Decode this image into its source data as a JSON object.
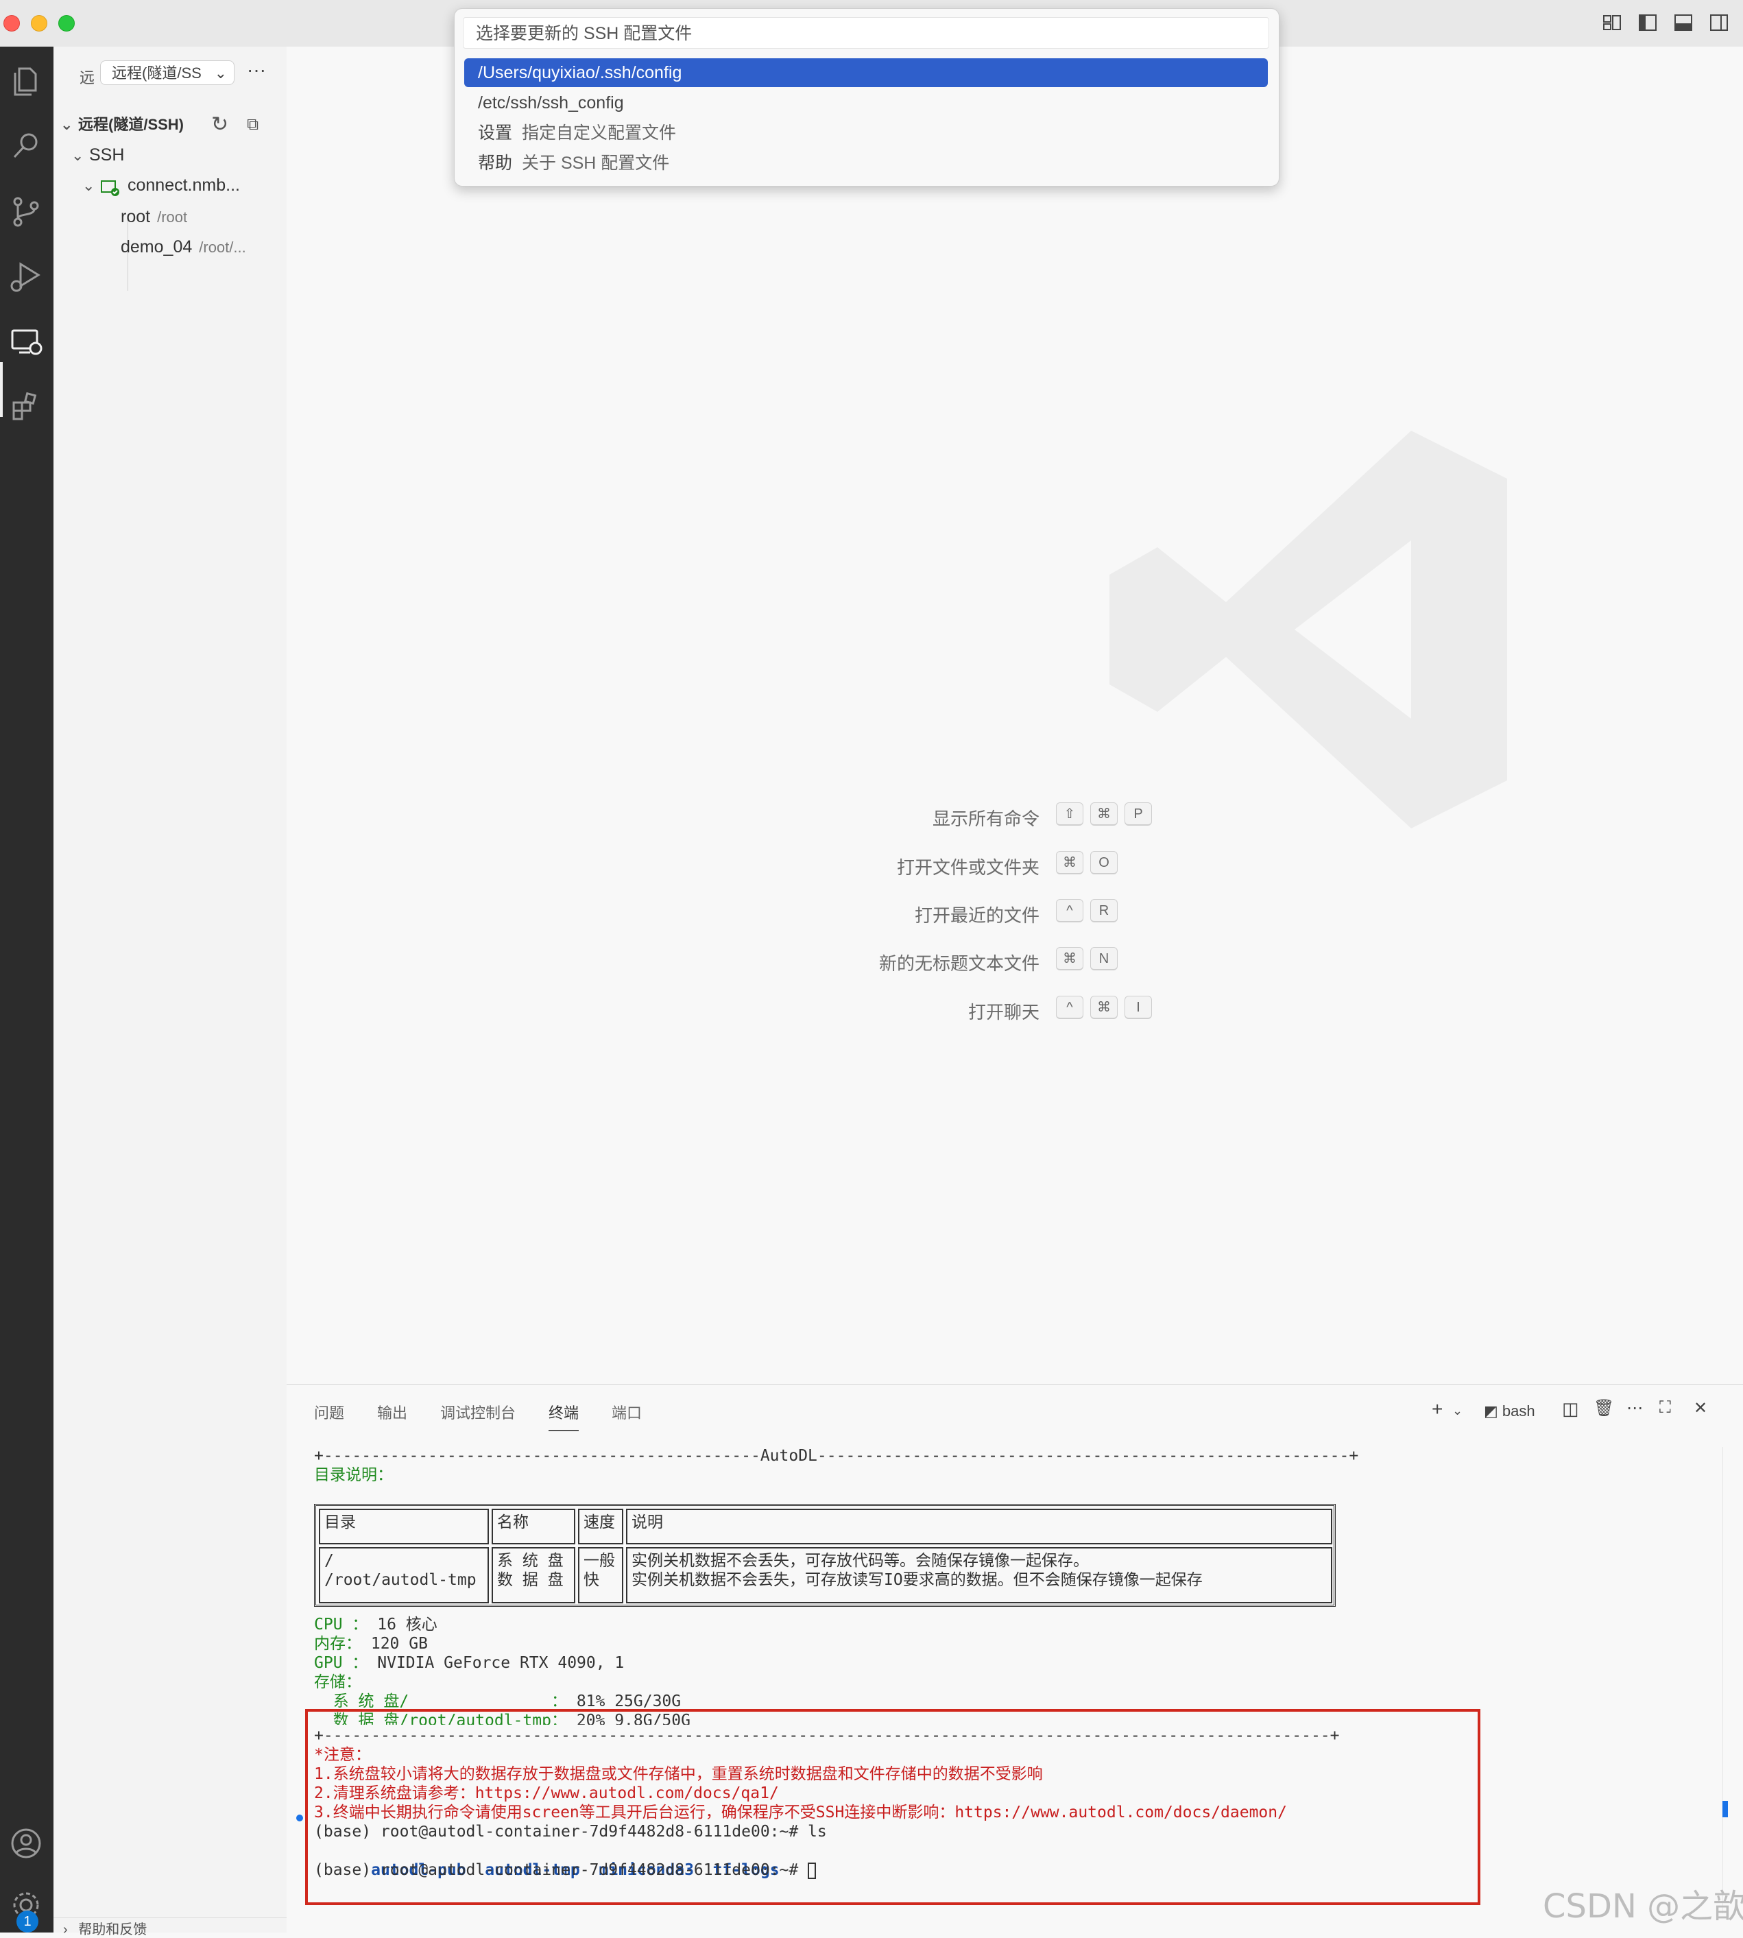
{
  "quickpick": {
    "placeholder": "选择要更新的 SSH 配置文件",
    "items": [
      {
        "label": "/Users/quyixiao/.ssh/config",
        "desc": ""
      },
      {
        "label": "/etc/ssh/ssh_config",
        "desc": ""
      },
      {
        "label": "设置",
        "desc": "指定自定义配置文件"
      },
      {
        "label": "帮助",
        "desc": "关于 SSH 配置文件"
      }
    ]
  },
  "sidebar": {
    "prefix": "远",
    "select_value": "远程(隧道/SS",
    "more": "···",
    "section_title": "远程(隧道/SSH)",
    "group": "SSH",
    "host": "connect.nmb...",
    "folders": [
      {
        "name": "root",
        "path": "/root"
      },
      {
        "name": "demo_04",
        "path": "/root/..."
      }
    ],
    "help": "帮助和反馈"
  },
  "activity": {
    "icons": [
      "files-icon",
      "search-icon",
      "source-control-icon",
      "run-debug-icon",
      "remote-explorer-icon",
      "extensions-icon",
      "account-icon",
      "settings-gear-icon"
    ],
    "badge": "1"
  },
  "shortcuts": [
    {
      "label": "显示所有命令",
      "keys": [
        "⇧",
        "⌘",
        "P"
      ]
    },
    {
      "label": "打开文件或文件夹",
      "keys": [
        "⌘",
        "O"
      ]
    },
    {
      "label": "打开最近的文件",
      "keys": [
        "^",
        "R"
      ]
    },
    {
      "label": "新的无标题文本文件",
      "keys": [
        "⌘",
        "N"
      ]
    },
    {
      "label": "打开聊天",
      "keys": [
        "^",
        "⌘",
        "I"
      ]
    }
  ],
  "panel": {
    "tabs": [
      "问题",
      "输出",
      "调试控制台",
      "终端",
      "端口"
    ],
    "active_tab": "终端",
    "shell": "bash"
  },
  "terminal": {
    "banner": "+----------------------------------------------AutoDL--------------------------------------------------------+",
    "dir_title": "目录说明：",
    "table": {
      "headers": [
        "目录",
        "名称",
        "速度",
        "说明"
      ],
      "col1": "/\n/root/autodl-tmp",
      "col2": "系 统 盘\n数 据 盘",
      "col3": "一般\n快",
      "col4": "实例关机数据不会丢失，可存放代码等。会随保存镜像一起保存。\n实例关机数据不会丢失，可存放读写IO要求高的数据。但不会随保存镜像一起保存"
    },
    "specs": [
      {
        "key": "CPU ：",
        "value": "16 核心"
      },
      {
        "key": "内存：",
        "value": "120 GB"
      },
      {
        "key": "GPU ：",
        "value": "NVIDIA GeForce RTX 4090, 1"
      },
      {
        "key": "存储：",
        "value": ""
      }
    ],
    "disk1_key": "  系 统 盘/               ：",
    "disk1_val": "81% 25G/30G",
    "disk2_key": "  数 据 盘/root/autodl-tmp：",
    "disk2_val": "20% 9.8G/50G",
    "separator": "+----------------------------------------------------------------------------------------------------------+",
    "notice_title": "*注意：",
    "notice_1": "1.系统盘较小请将大的数据存放于数据盘或文件存储中，重置系统时数据盘和文件存储中的数据不受影响",
    "notice_2": "2.清理系统盘请参考：https://www.autodl.com/docs/qa1/",
    "notice_3": "3.终端中长期执行命令请使用screen等工具开后台运行，确保程序不受SSH连接中断影响：https://www.autodl.com/docs/daemon/",
    "prompt_ls": "(base) root@autodl-container-7d9f4482d8-6111de00:~# ls",
    "ls_items": [
      "autodl-pub",
      "autodl-tmp",
      "miniconda3",
      "tf-logs"
    ],
    "prompt": "(base) root@autodl-container-7d9f4482d8-6111de00:~# "
  },
  "watermark_text": "CSDN @之歆",
  "colors": {
    "accent": "#2f5fcb",
    "highlight_border": "#d0281d",
    "activitybar": "#2c2c2c",
    "terminal_green": "#1f8a1f",
    "terminal_red": "#c81e1e"
  }
}
